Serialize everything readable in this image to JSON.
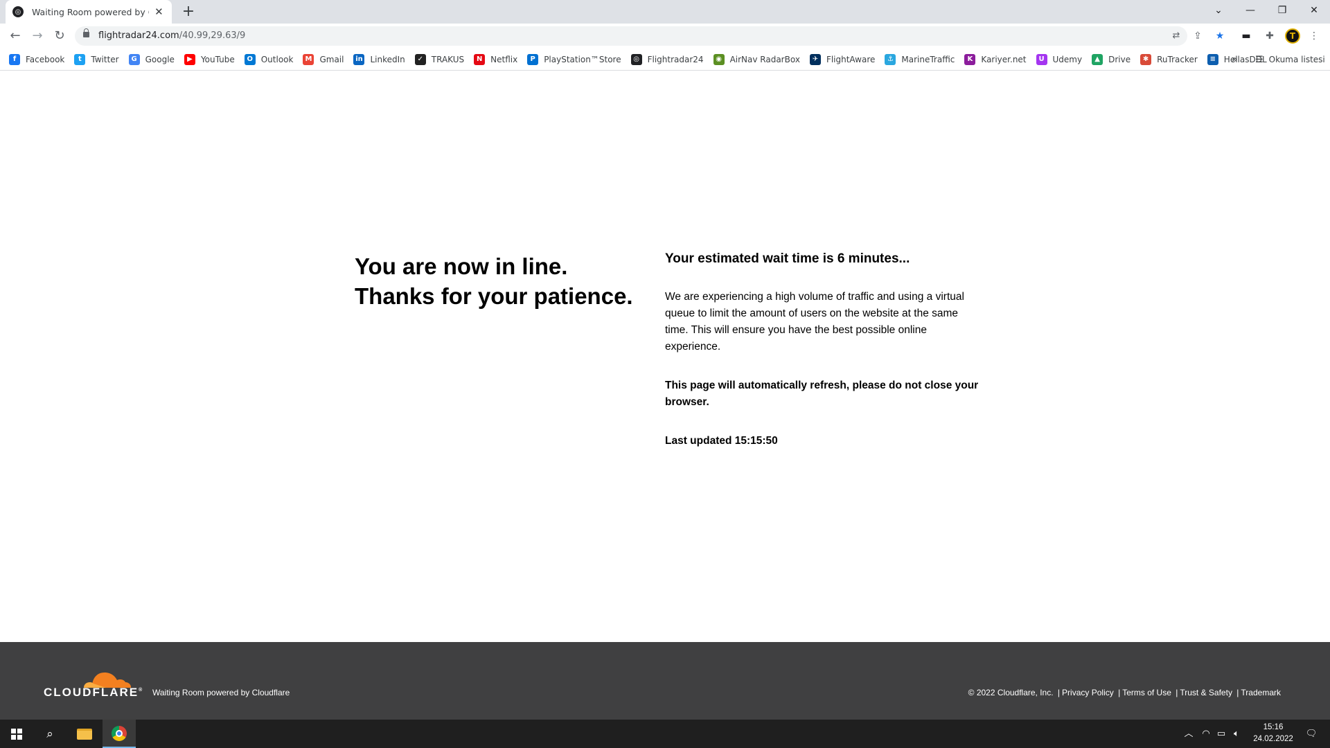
{
  "browser": {
    "tab_title": "Waiting Room powered by Cloudflare",
    "url_host": "flightradar24.com",
    "url_path": "/40.99,29.63/9",
    "new_tab": "+",
    "bookmarks": [
      {
        "label": "Facebook",
        "icon": "facebook-icon",
        "color": "#1877f2",
        "glyph": "f"
      },
      {
        "label": "Twitter",
        "icon": "twitter-icon",
        "color": "#1da1f2",
        "glyph": "t"
      },
      {
        "label": "Google",
        "icon": "google-icon",
        "color": "#4285f4",
        "glyph": "G"
      },
      {
        "label": "YouTube",
        "icon": "youtube-icon",
        "color": "#ff0000",
        "glyph": "▶"
      },
      {
        "label": "Outlook",
        "icon": "outlook-icon",
        "color": "#0078d4",
        "glyph": "O"
      },
      {
        "label": "Gmail",
        "icon": "gmail-icon",
        "color": "#ea4335",
        "glyph": "M"
      },
      {
        "label": "LinkedIn",
        "icon": "linkedin-icon",
        "color": "#0a66c2",
        "glyph": "in"
      },
      {
        "label": "TRAKUS",
        "icon": "trakus-icon",
        "color": "#222222",
        "glyph": "✓"
      },
      {
        "label": "Netflix",
        "icon": "netflix-icon",
        "color": "#e50914",
        "glyph": "N"
      },
      {
        "label": "PlayStation™Store",
        "icon": "playstation-icon",
        "color": "#0070d1",
        "glyph": "P"
      },
      {
        "label": "Flightradar24",
        "icon": "flightradar-icon",
        "color": "#202124",
        "glyph": "◎"
      },
      {
        "label": "AirNav RadarBox",
        "icon": "radarbox-icon",
        "color": "#5b8f22",
        "glyph": "◉"
      },
      {
        "label": "FlightAware",
        "icon": "flightaware-icon",
        "color": "#002f5d",
        "glyph": "✈"
      },
      {
        "label": "MarineTraffic",
        "icon": "marinetraffic-icon",
        "color": "#2aa7df",
        "glyph": "⚓"
      },
      {
        "label": "Kariyer.net",
        "icon": "kariyer-icon",
        "color": "#8c1d9c",
        "glyph": "K"
      },
      {
        "label": "Udemy",
        "icon": "udemy-icon",
        "color": "#a435f0",
        "glyph": "U"
      },
      {
        "label": "Drive",
        "icon": "drive-icon",
        "color": "#1fa463",
        "glyph": "▲"
      },
      {
        "label": "RuTracker",
        "icon": "rutracker-icon",
        "color": "#d84a38",
        "glyph": "✱"
      },
      {
        "label": "HellasDDL",
        "icon": "hellas-flag-icon",
        "color": "#0d5eaf",
        "glyph": "≡"
      }
    ],
    "overflow": "»",
    "reading_list": "Okuma listesi"
  },
  "content": {
    "headline_line1": "You are now in line.",
    "headline_line2": "Thanks for your patience.",
    "wait_time": "Your estimated wait time is 6 minutes...",
    "paragraph": "We are experiencing a high volume of traffic and using a virtual queue to limit the amount of users on the website at the same time. This will ensure you have the best possible online experience.",
    "refresh_notice": "This page will automatically refresh, please do not close your browser.",
    "last_updated": "Last updated 15:15:50"
  },
  "footer": {
    "logo_text": "CLOUDFLARE",
    "logo_mark": "®",
    "powered_by": "Waiting Room powered by Cloudflare",
    "copyright": "© 2022 Cloudflare, Inc.",
    "links": [
      "Privacy Policy",
      "Terms of Use",
      "Trust & Safety",
      "Trademark"
    ],
    "separator": "|",
    "brand_color": "#f38020"
  },
  "taskbar": {
    "time": "15:16",
    "date": "24.02.2022"
  }
}
